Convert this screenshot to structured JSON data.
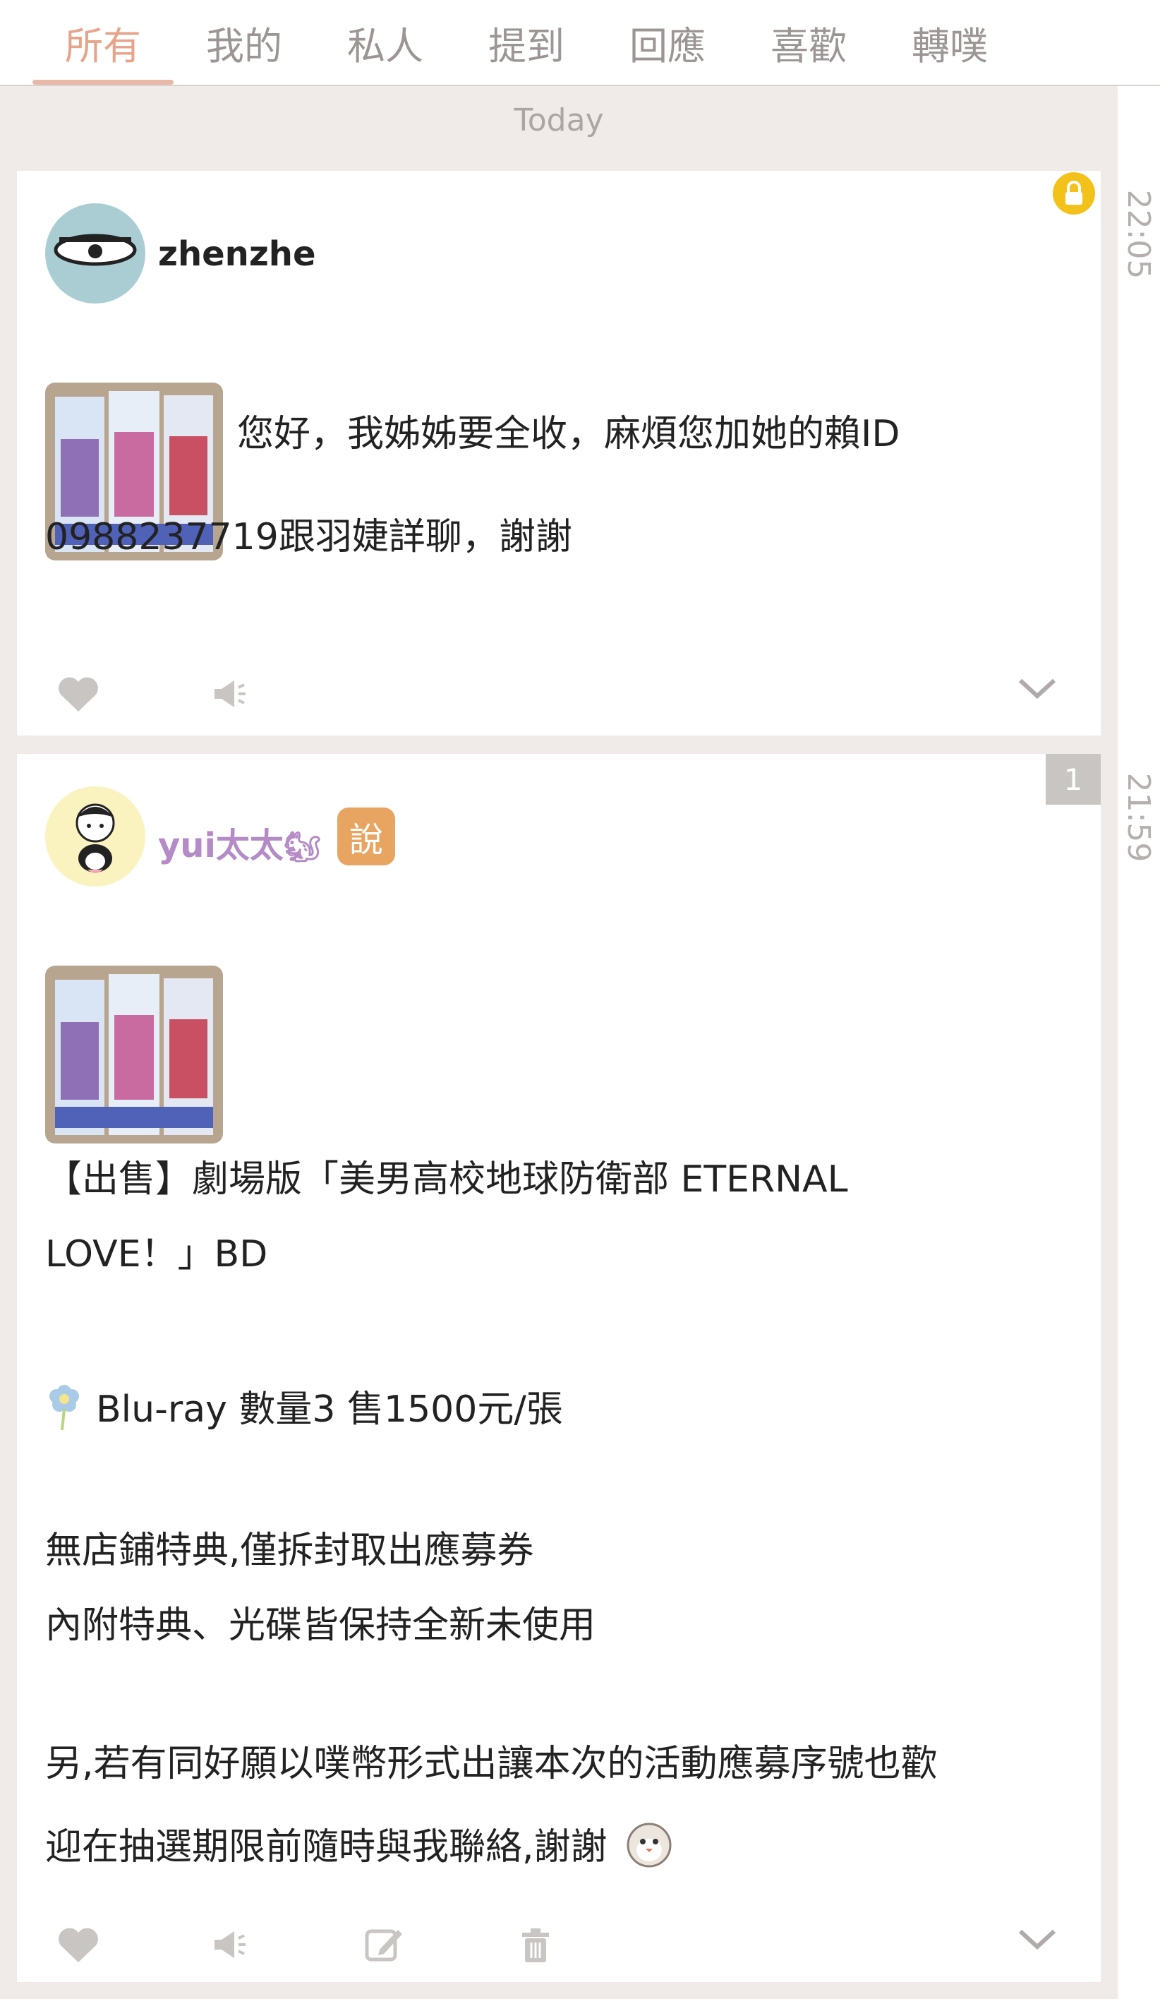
{
  "tabs": [
    {
      "label": "所有",
      "active": true
    },
    {
      "label": "我的"
    },
    {
      "label": "私人"
    },
    {
      "label": "提到"
    },
    {
      "label": "回應"
    },
    {
      "label": "喜歡"
    },
    {
      "label": "轉噗"
    }
  ],
  "day_separator": "Today",
  "posts": [
    {
      "time": "22:05",
      "author": "zhenzhe",
      "private": true,
      "text_line1": "您好，我姊姊要全收，麻煩您加她的賴ID",
      "text_line2": "0988237719跟羽婕詳聊，謝謝"
    },
    {
      "time": "21:59",
      "author": "yui太太",
      "author_emoji": "🐿",
      "qualifier": "說",
      "response_count": "1",
      "lines": [
        "【出售】劇場版「美男高校地球防衛部 ETERNAL",
        "LOVE！」BD",
        "Blu-ray 數量3 售1500元/張",
        "無店鋪特典,僅拆封取出應募券",
        "內附特典、光碟皆保持全新未使用",
        "另,若有同好願以噗幣形式出讓本次的活動應募序號也歡",
        "迎在抽選期限前隨時與我聯絡,謝謝"
      ]
    }
  ],
  "colors": {
    "accent": "#e8a48a",
    "background": "#f0ebe9",
    "name_purple": "#b48ac7",
    "badge_orange": "#e8a561",
    "lock_yellow": "#f2c21b"
  }
}
